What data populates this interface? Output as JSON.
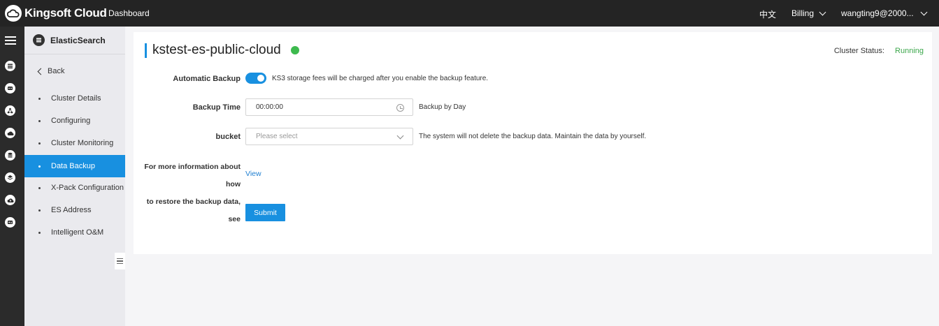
{
  "topbar": {
    "brand": "Kingsoft Cloud",
    "dashboard": "Dashboard",
    "language": "中文",
    "billing": "Billing",
    "user": "wangting9@2000...",
    "icons": [
      "cloud-logo-icon",
      "chevron-down-icon"
    ]
  },
  "rail": {
    "icons": [
      "menu-icon",
      "database-icon",
      "robot-icon",
      "network-icon",
      "cloud-storage-icon",
      "database-stack-icon",
      "layers-icon",
      "cloud-upload-icon",
      "id-card-icon"
    ]
  },
  "sidebar": {
    "title": "ElasticSearch",
    "back": "Back",
    "items": [
      {
        "label": "Cluster Details",
        "active": false
      },
      {
        "label": "Configuring",
        "active": false
      },
      {
        "label": "Cluster Monitoring",
        "active": false
      },
      {
        "label": "Data Backup",
        "active": true
      },
      {
        "label": "X-Pack Configuration",
        "active": false
      },
      {
        "label": "ES Address",
        "active": false
      },
      {
        "label": "Intelligent O&M",
        "active": false
      }
    ]
  },
  "main": {
    "title": "kstest-es-public-cloud",
    "status_label": "Cluster Status:",
    "status_value": "Running",
    "form": {
      "auto_backup_label": "Automatic Backup",
      "auto_backup_enabled": true,
      "auto_backup_hint": "KS3 storage fees will be charged after you enable the backup feature.",
      "backup_time_label": "Backup Time",
      "backup_time_value": "00:00:00",
      "backup_time_hint": "Backup by Day",
      "bucket_label": "bucket",
      "bucket_placeholder": "Please select",
      "bucket_hint": "The system will not delete the backup data. Maintain the data by yourself.",
      "more_info_line1": "For more information about how",
      "more_info_line2": "to restore the backup data, see",
      "view_link": "View",
      "submit": "Submit"
    }
  },
  "colors": {
    "accent": "#1890e0",
    "running": "#3aa64a",
    "topbar_bg": "#242424"
  }
}
